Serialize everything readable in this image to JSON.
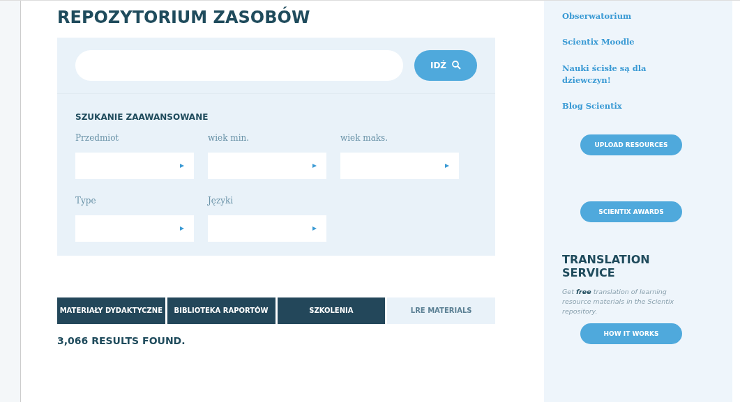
{
  "page": {
    "title": "REPOZYTORIUM ZASOBÓW"
  },
  "search": {
    "button": "IDŹ"
  },
  "advanced": {
    "title": "SZUKANIE ZAAWANSOWANE",
    "filters": [
      {
        "label": "Przedmiot"
      },
      {
        "label": "wiek min."
      },
      {
        "label": "wiek maks."
      },
      {
        "label": "Type"
      },
      {
        "label": "Języki"
      }
    ]
  },
  "tabs": [
    {
      "label": "MATERIAŁY DYDAKTYCZNE",
      "selected": false
    },
    {
      "label": "BIBLIOTEKA RAPORTÓW",
      "selected": false
    },
    {
      "label": "SZKOLENIA",
      "selected": false
    },
    {
      "label": "LRE MATERIALS",
      "selected": true
    }
  ],
  "results": "3,066 RESULTS FOUND.",
  "sidebar": {
    "links": [
      "Obserwatorium",
      "Scientix Moodle",
      "Nauki ścisłe są dla dziewczyn!",
      "Blog Scientix"
    ],
    "buttons": [
      "UPLOAD RESOURCES",
      "SCIENTIX AWARDS"
    ],
    "translation": {
      "title": "TRANSLATION SERVICE",
      "text": "Get **free** translation of learning resource materials in the Scientix repository.",
      "button": "HOW IT WORKS"
    }
  }
}
